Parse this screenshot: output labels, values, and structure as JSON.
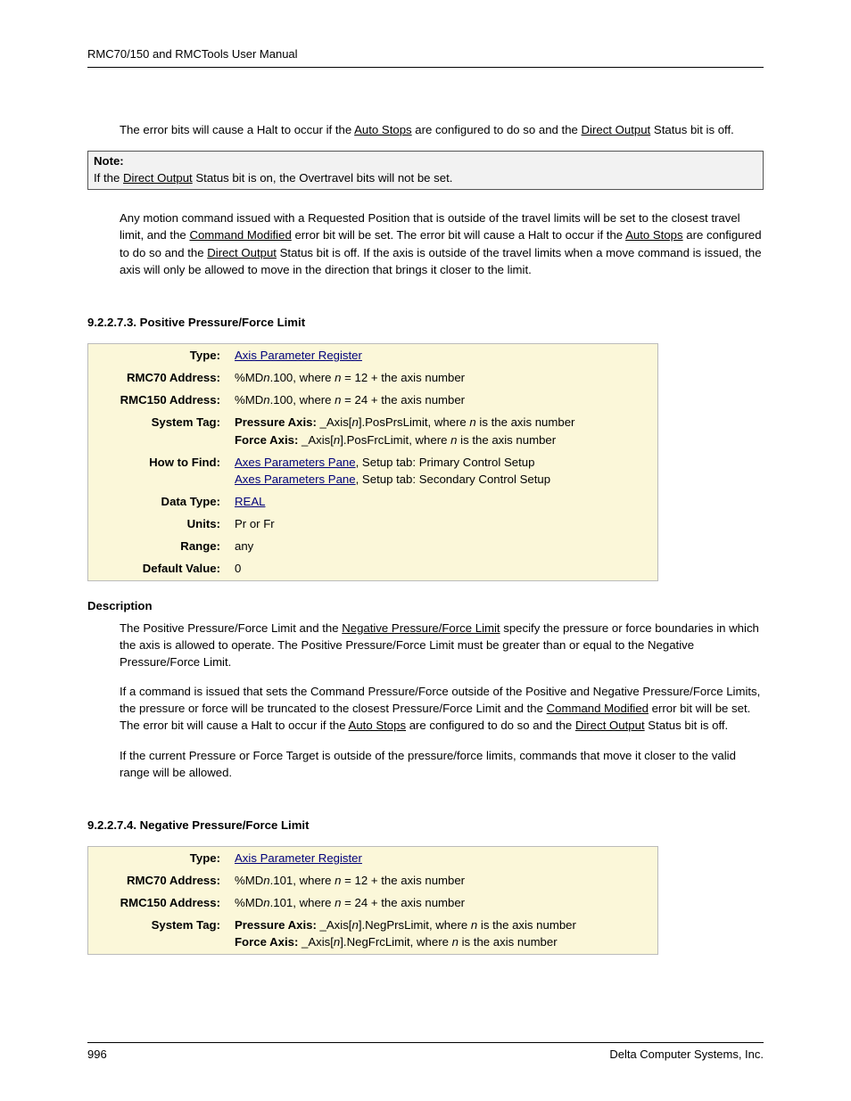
{
  "header": {
    "title": "RMC70/150 and RMCTools User Manual"
  },
  "para1": {
    "t1": "The error bits will cause a Halt to occur if the ",
    "link1": "Auto Stops",
    "t2": " are configured to do so and the ",
    "link2": "Direct Output",
    "t3": " Status bit is off."
  },
  "note": {
    "label": "Note:",
    "t1": "If the ",
    "link1": "Direct Output",
    "t2": " Status bit is on, the Overtravel bits will not be set."
  },
  "para2": {
    "t1": "Any motion command issued with a Requested Position that is outside of the travel limits will be set to the closest travel limit, and the ",
    "link1": "Command Modified",
    "t2": " error bit will be set. The error bit will cause a Halt to occur if the ",
    "link2": "Auto Stops",
    "t3": " are configured to do so and the ",
    "link3": "Direct Output",
    "t4": " Status bit is off. If the axis is outside of the travel limits when a move command is issued, the axis will only be allowed to move in the direction that brings it closer to the limit."
  },
  "section1": {
    "heading": "9.2.2.7.3. Positive Pressure/Force Limit",
    "rows": {
      "type": {
        "label": "Type:",
        "link": "Axis Parameter Register"
      },
      "rmc70": {
        "label": "RMC70 Address:",
        "pre": "%MD",
        "n": "n",
        "post": ".100, where ",
        "n2": "n",
        "eq": " = 12 + the axis number"
      },
      "rmc150": {
        "label": "RMC150 Address:",
        "pre": "%MD",
        "n": "n",
        "post": ".100, where ",
        "n2": "n",
        "eq": " = 24 + the axis number"
      },
      "systag": {
        "label": "System Tag:",
        "pa_label": "Pressure Axis:  ",
        "pa_t1": "_Axis[",
        "pa_n": "n",
        "pa_t2": "].PosPrsLimit, where ",
        "pa_n2": "n",
        "pa_t3": " is the axis number",
        "fa_label": "Force Axis:  ",
        "fa_t1": "_Axis[",
        "fa_n": "n",
        "fa_t2": "].PosFrcLimit, where ",
        "fa_n2": "n",
        "fa_t3": " is the axis number"
      },
      "howto": {
        "label": "How to Find:",
        "link1": "Axes Parameters Pane",
        "t1": ", Setup tab: Primary Control Setup",
        "link2": "Axes Parameters Pane",
        "t2": ", Setup tab: Secondary Control Setup"
      },
      "datatype": {
        "label": "Data Type:",
        "link": "REAL"
      },
      "units": {
        "label": "Units:",
        "val": "Pr or Fr"
      },
      "range": {
        "label": "Range:",
        "val": "any"
      },
      "default": {
        "label": "Default Value:",
        "val": "0"
      }
    }
  },
  "description": {
    "heading": "Description",
    "p1_t1": "The Positive Pressure/Force Limit and the ",
    "p1_link1": "Negative Pressure/Force Limit",
    "p1_t2": " specify the pressure or force boundaries in which the axis is allowed to operate. The Positive Pressure/Force Limit must be greater than or equal to the Negative Pressure/Force Limit.",
    "p2_t1": "If a command is issued that sets the Command Pressure/Force outside of the Positive and Negative Pressure/Force Limits, the pressure or force will be truncated to the closest Pressure/Force Limit and the ",
    "p2_link1": "Command Modified",
    "p2_t2": " error bit will be set. The error bit will cause a Halt to occur if the ",
    "p2_link2": "Auto Stops",
    "p2_t3": " are configured to do so and the ",
    "p2_link3": "Direct Output",
    "p2_t4": " Status bit is off.",
    "p3": "If the current Pressure or Force Target is outside of the pressure/force limits, commands that move it closer to the valid range will be allowed."
  },
  "section2": {
    "heading": "9.2.2.7.4. Negative Pressure/Force Limit",
    "rows": {
      "type": {
        "label": "Type:",
        "link": "Axis Parameter Register"
      },
      "rmc70": {
        "label": "RMC70 Address:",
        "pre": "%MD",
        "n": "n",
        "post": ".101, where ",
        "n2": "n",
        "eq": " = 12 + the axis number"
      },
      "rmc150": {
        "label": "RMC150 Address:",
        "pre": "%MD",
        "n": "n",
        "post": ".101, where ",
        "n2": "n",
        "eq": " = 24 + the axis number"
      },
      "systag": {
        "label": "System Tag:",
        "pa_label": "Pressure Axis:  ",
        "pa_t1": "_Axis[",
        "pa_n": "n",
        "pa_t2": "].NegPrsLimit, where ",
        "pa_n2": "n",
        "pa_t3": " is the axis number",
        "fa_label": "Force Axis:  ",
        "fa_t1": "_Axis[",
        "fa_n": "n",
        "fa_t2": "].NegFrcLimit, where ",
        "fa_n2": "n",
        "fa_t3": " is the axis number"
      }
    }
  },
  "footer": {
    "page": "996",
    "company": "Delta Computer Systems, Inc."
  }
}
